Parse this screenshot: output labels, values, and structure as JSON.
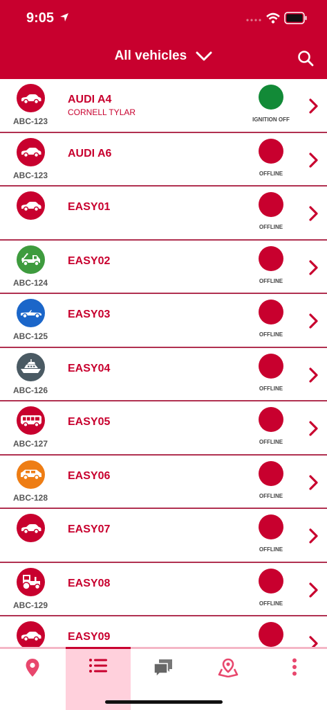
{
  "status_bar": {
    "time": "9:05"
  },
  "header": {
    "title": "All vehicles"
  },
  "vehicles": [
    {
      "plate": "ABC-123",
      "name": "AUDI A4",
      "driver": "CORNELL TYLAR",
      "status": "IGNITION OFF",
      "status_color": "#128a37",
      "icon": "car-icon",
      "avatar_color": "#c8002e"
    },
    {
      "plate": "ABC-123",
      "name": "AUDI A6",
      "driver": "",
      "status": "OFFLINE",
      "status_color": "#c8002e",
      "icon": "car-icon",
      "avatar_color": "#c8002e"
    },
    {
      "plate": "",
      "name": "EASY01",
      "driver": "",
      "status": "OFFLINE",
      "status_color": "#c8002e",
      "icon": "car-icon",
      "avatar_color": "#c8002e"
    },
    {
      "plate": "ABC-124",
      "name": "EASY02",
      "driver": "",
      "status": "OFFLINE",
      "status_color": "#c8002e",
      "icon": "tow-truck-icon",
      "avatar_color": "#3e9b3e"
    },
    {
      "plate": "ABC-125",
      "name": "EASY03",
      "driver": "",
      "status": "OFFLINE",
      "status_color": "#c8002e",
      "icon": "convertible-icon",
      "avatar_color": "#1b66c9"
    },
    {
      "plate": "ABC-126",
      "name": "EASY04",
      "driver": "",
      "status": "OFFLINE",
      "status_color": "#c8002e",
      "icon": "boat-icon",
      "avatar_color": "#4a5a63"
    },
    {
      "plate": "ABC-127",
      "name": "EASY05",
      "driver": "",
      "status": "OFFLINE",
      "status_color": "#c8002e",
      "icon": "bus-icon",
      "avatar_color": "#c8002e"
    },
    {
      "plate": "ABC-128",
      "name": "EASY06",
      "driver": "",
      "status": "OFFLINE",
      "status_color": "#c8002e",
      "icon": "suv-icon",
      "avatar_color": "#ee7d14"
    },
    {
      "plate": "",
      "name": "EASY07",
      "driver": "",
      "status": "OFFLINE",
      "status_color": "#c8002e",
      "icon": "car-icon",
      "avatar_color": "#c8002e"
    },
    {
      "plate": "ABC-129",
      "name": "EASY08",
      "driver": "",
      "status": "OFFLINE",
      "status_color": "#c8002e",
      "icon": "tractor-icon",
      "avatar_color": "#c8002e"
    },
    {
      "plate": "",
      "name": "EASY09",
      "driver": "",
      "status": "",
      "status_color": "#c8002e",
      "icon": "car-icon",
      "avatar_color": "#c8002e"
    }
  ],
  "tabbar": {
    "tabs": [
      {
        "id": "map",
        "icon": "location-pin-icon",
        "active": false
      },
      {
        "id": "list",
        "icon": "list-icon",
        "active": true
      },
      {
        "id": "messages",
        "icon": "chat-icon",
        "active": false
      },
      {
        "id": "places",
        "icon": "place-icon",
        "active": false
      },
      {
        "id": "more",
        "icon": "more-vertical-icon",
        "active": false
      }
    ]
  },
  "colors": {
    "brand": "#c8002e",
    "active_tab_bg": "#ffd0dc",
    "separator": "#b03050"
  }
}
